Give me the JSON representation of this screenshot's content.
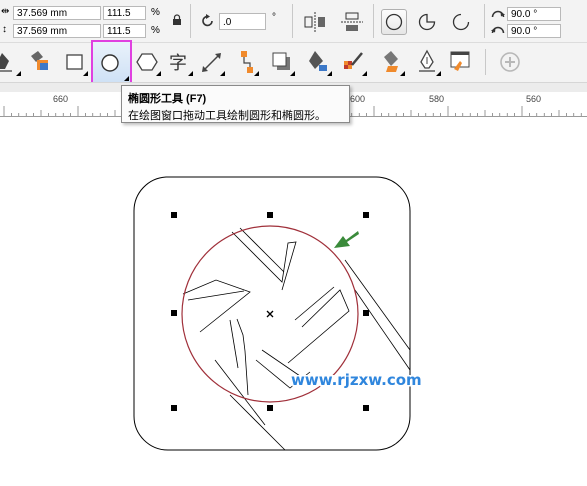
{
  "property_bar": {
    "width_value": "37.569 mm",
    "height_value": "37.569 mm",
    "scale_x": "111.5",
    "scale_y": "111.5",
    "percent_symbol": "%",
    "rotation_value": ".0",
    "degree_symbol": "°",
    "start_angle": "90.0 °",
    "end_angle": "90.0 °",
    "icons": [
      "width-icon",
      "height-icon",
      "lock-ratio-icon",
      "rotate-icon",
      "mirror-horizontal-icon",
      "mirror-vertical-icon",
      "ellipse-mode-icon",
      "pie-mode-icon",
      "arc-mode-icon",
      "start-angle-icon",
      "end-angle-icon"
    ]
  },
  "toolbox": {
    "tools": [
      "freehand-tool",
      "smart-fill-tool",
      "rectangle-tool",
      "ellipse-tool",
      "polygon-tool",
      "text-tool",
      "dimension-tool",
      "connector-tool",
      "drop-shadow-tool",
      "transparency-tool",
      "eyedropper-tool",
      "fill-tool",
      "outline-pen-tool",
      "document-palette-tool",
      "add-tool"
    ],
    "selected_tool": "ellipse-tool",
    "highlight_color": "#e040e0"
  },
  "ruler": {
    "labels": [
      "660",
      "600",
      "580",
      "560"
    ]
  },
  "tooltip": {
    "title": "椭圆形工具 (F7)",
    "description": "在绘图窗口拖动工具绘制圆形和椭圆形。"
  },
  "canvas": {
    "watermark": "www.rjzxw.com",
    "circle_outline_color": "#a0303a",
    "arrow_color": "#3a8a3a"
  }
}
